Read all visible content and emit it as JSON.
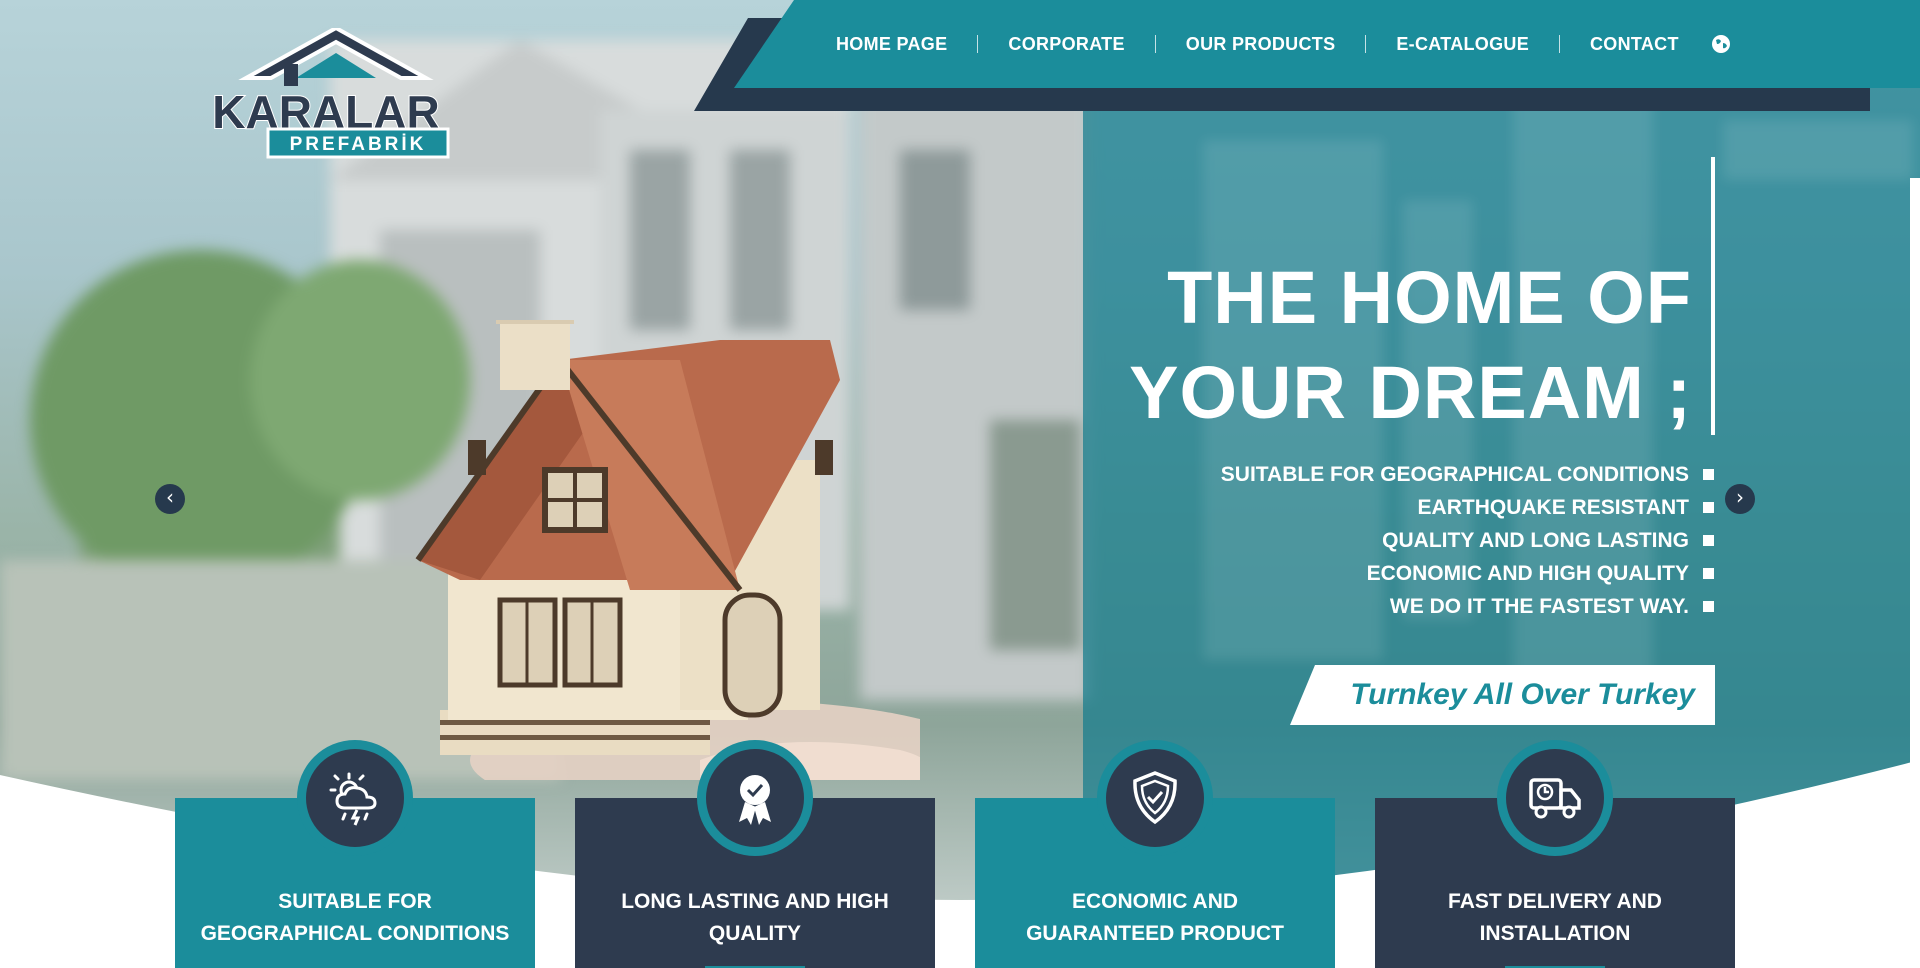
{
  "brand": {
    "name": "KARALAR",
    "sub": "PREFABRİK"
  },
  "nav": {
    "items": [
      {
        "label": "HOME PAGE"
      },
      {
        "label": "CORPORATE"
      },
      {
        "label": "OUR PRODUCTS"
      },
      {
        "label": "E-CATALOGUE"
      },
      {
        "label": "CONTACT"
      }
    ],
    "language_icon": "globe-icon"
  },
  "hero": {
    "title_line1": "THE HOME OF",
    "title_line2": "YOUR DREAM ;",
    "features": [
      "SUITABLE FOR GEOGRAPHICAL CONDITIONS",
      "EARTHQUAKE RESISTANT",
      "QUALITY AND LONG LASTING",
      "ECONOMIC AND HIGH QUALITY",
      "WE DO IT THE FASTEST WAY."
    ],
    "cta": "Turnkey All Over Turkey",
    "prev_arrow": "‹",
    "next_arrow": "›"
  },
  "cards": [
    {
      "title": "SUITABLE FOR GEOGRAPHICAL CONDITIONS",
      "icon": "weather-icon",
      "style": "teal"
    },
    {
      "title": "LONG LASTING AND HIGH QUALITY",
      "icon": "award-ribbon-icon",
      "style": "dark"
    },
    {
      "title": "ECONOMIC AND GUARANTEED PRODUCT",
      "icon": "shield-check-icon",
      "style": "teal"
    },
    {
      "title": "FAST DELIVERY AND INSTALLATION",
      "icon": "delivery-truck-icon",
      "style": "dark"
    }
  ],
  "colors": {
    "teal": "#1b8d9b",
    "navy": "#2e3b4f",
    "dark_nav": "#26394d",
    "white": "#ffffff"
  }
}
